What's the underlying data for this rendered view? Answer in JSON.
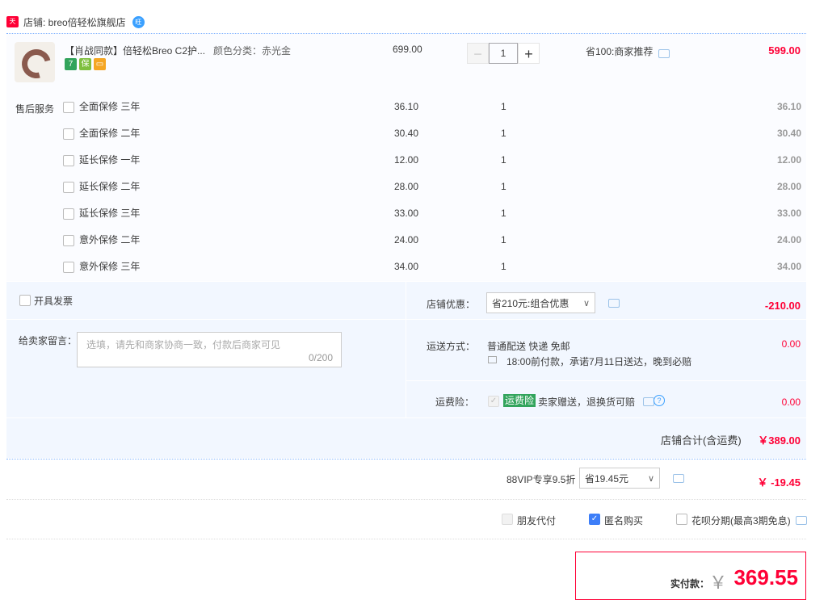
{
  "store": {
    "badge": "天猫",
    "label": "店铺: breo倍轻松旗舰店"
  },
  "item": {
    "title": "【肖战同款】倍轻松Breo C2护...",
    "sku": "颜色分类：赤光金",
    "price": "699.00",
    "qty": "1",
    "promo": "省100:商家推荐",
    "total": "599.00"
  },
  "services": {
    "label": "售后服务",
    "rows": [
      {
        "name": "全面保修 三年",
        "price": "36.10",
        "qty": "1",
        "total": "36.10"
      },
      {
        "name": "全面保修 二年",
        "price": "30.40",
        "qty": "1",
        "total": "30.40"
      },
      {
        "name": "延长保修 一年",
        "price": "12.00",
        "qty": "1",
        "total": "12.00"
      },
      {
        "name": "延长保修 二年",
        "price": "28.00",
        "qty": "1",
        "total": "28.00"
      },
      {
        "name": "延长保修 三年",
        "price": "33.00",
        "qty": "1",
        "total": "33.00"
      },
      {
        "name": "意外保修 二年",
        "price": "24.00",
        "qty": "1",
        "total": "24.00"
      },
      {
        "name": "意外保修 三年",
        "price": "34.00",
        "qty": "1",
        "total": "34.00"
      }
    ]
  },
  "invoice": {
    "label": "开具发票"
  },
  "message": {
    "label": "给卖家留言：",
    "placeholder": "选填，请先和商家协商一致，付款后商家可见",
    "counter": "0/200"
  },
  "discount": {
    "label": "店铺优惠：",
    "selected": "省210元:组合优惠",
    "amount": "-210.00"
  },
  "shipping": {
    "label": "运送方式：",
    "method": "普通配送 快递 免邮",
    "promise": "18:00前付款，承诺7月11日送达，晚到必赔",
    "amount": "0.00"
  },
  "insurance": {
    "label": "运费险：",
    "tag": "运费险",
    "desc": "卖家赠送，退换货可赔",
    "amount": "0.00"
  },
  "store_total": {
    "label": "店铺合计(含运费)",
    "amount": "￥389.00"
  },
  "vip": {
    "label": "88VIP专享9.5折",
    "selected": "省19.45元",
    "amount": "￥ -19.45"
  },
  "options": {
    "friend_pay": "朋友代付",
    "anonymous": "匿名购买",
    "huabei": "花呗分期(最高3期免息)"
  },
  "payment": {
    "label": "实付款：",
    "currency": "￥",
    "amount": "369.55"
  },
  "colors": {
    "accent_red": "#ff0036",
    "panel_blue": "#f2f7ff",
    "check_blue": "#3d7ef8",
    "tag_green": "#32a45c"
  }
}
